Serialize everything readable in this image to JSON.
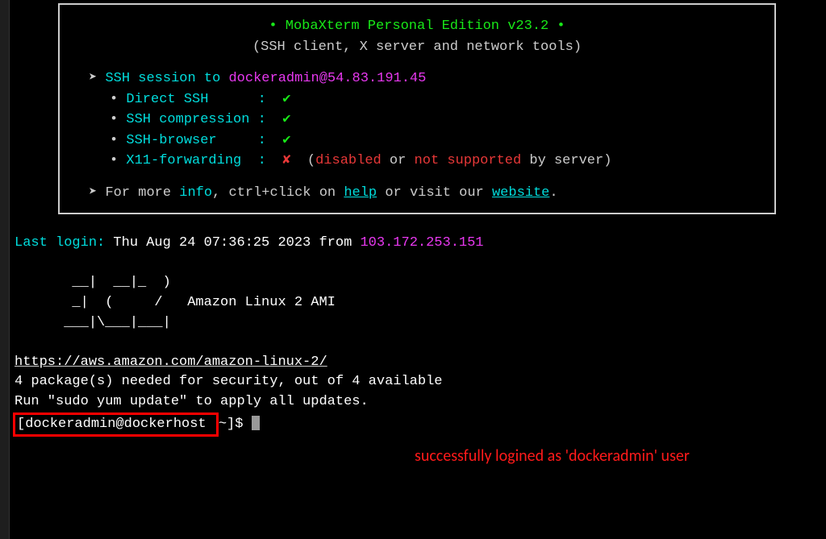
{
  "banner": {
    "title_bullet": "•",
    "title": "MobaXterm Personal Edition v23.2",
    "subtitle": "(SSH client, X server and network tools)",
    "arrow": "➤",
    "bullet": "•",
    "session_prefix": "SSH session to ",
    "session_target": "dockeradmin@54.83.191.45",
    "items": [
      {
        "label": "Direct SSH      : ",
        "mark": "✔"
      },
      {
        "label": "SSH compression : ",
        "mark": "✔"
      },
      {
        "label": "SSH-browser     : ",
        "mark": "✔"
      },
      {
        "label": "X11-forwarding  : ",
        "mark": "✘",
        "note_open": "  (",
        "note_1": "disabled",
        "note_or": " or ",
        "note_2": "not supported",
        "note_close": " by server)"
      }
    ],
    "more_prefix": "For more ",
    "more_info": "info",
    "more_mid": ", ctrl+click on ",
    "more_help": "help",
    "more_mid2": " or visit our ",
    "more_site": "website",
    "more_end": "."
  },
  "login": {
    "label": "Last login:",
    "time": " Thu Aug 24 07:36:25 2023 from ",
    "ip": "103.172.253.151"
  },
  "motd": {
    "ascii1": "       __|  __|_  )",
    "ascii2": "       _|  (     /   Amazon Linux 2 AMI",
    "ascii3": "      ___|\\___|___|",
    "url": "https://aws.amazon.com/amazon-linux-2/",
    "sec": "4 package(s) needed for security, out of 4 available",
    "run": "Run \"sudo yum update\" to apply all updates."
  },
  "prompt": {
    "user_host": "[dockeradmin@dockerhost ",
    "rest": "~]$ "
  },
  "annotation": "successfully logined as 'dockeradmin' user"
}
